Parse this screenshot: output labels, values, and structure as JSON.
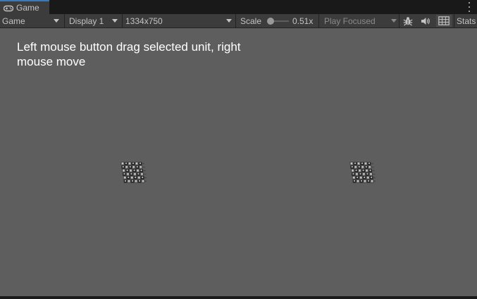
{
  "tab": {
    "title": "Game",
    "icon": "gamepad-icon"
  },
  "toolbar": {
    "mode": "Game",
    "display": "Display 1",
    "resolution": "1334x750",
    "scale_label": "Scale",
    "scale_value": "0.51x",
    "play_mode": "Play Focused",
    "stats_label": "Stats",
    "icons": [
      "bug-icon",
      "speaker-icon",
      "gizmos-icon"
    ]
  },
  "viewport": {
    "instructions": "Left mouse button drag selected unit, right mouse move",
    "unit_groups": [
      {
        "name": "left-unit-group",
        "columns": 6,
        "rows": 6
      },
      {
        "name": "right-unit-group",
        "columns": 6,
        "rows": 6
      }
    ]
  },
  "colors": {
    "viewport_bg": "#5e5e5e",
    "toolbar_bg": "#3c3c3c",
    "tabbar_bg": "#191919",
    "tab_accent": "#3a79bb",
    "text": "#c4c4c4"
  }
}
